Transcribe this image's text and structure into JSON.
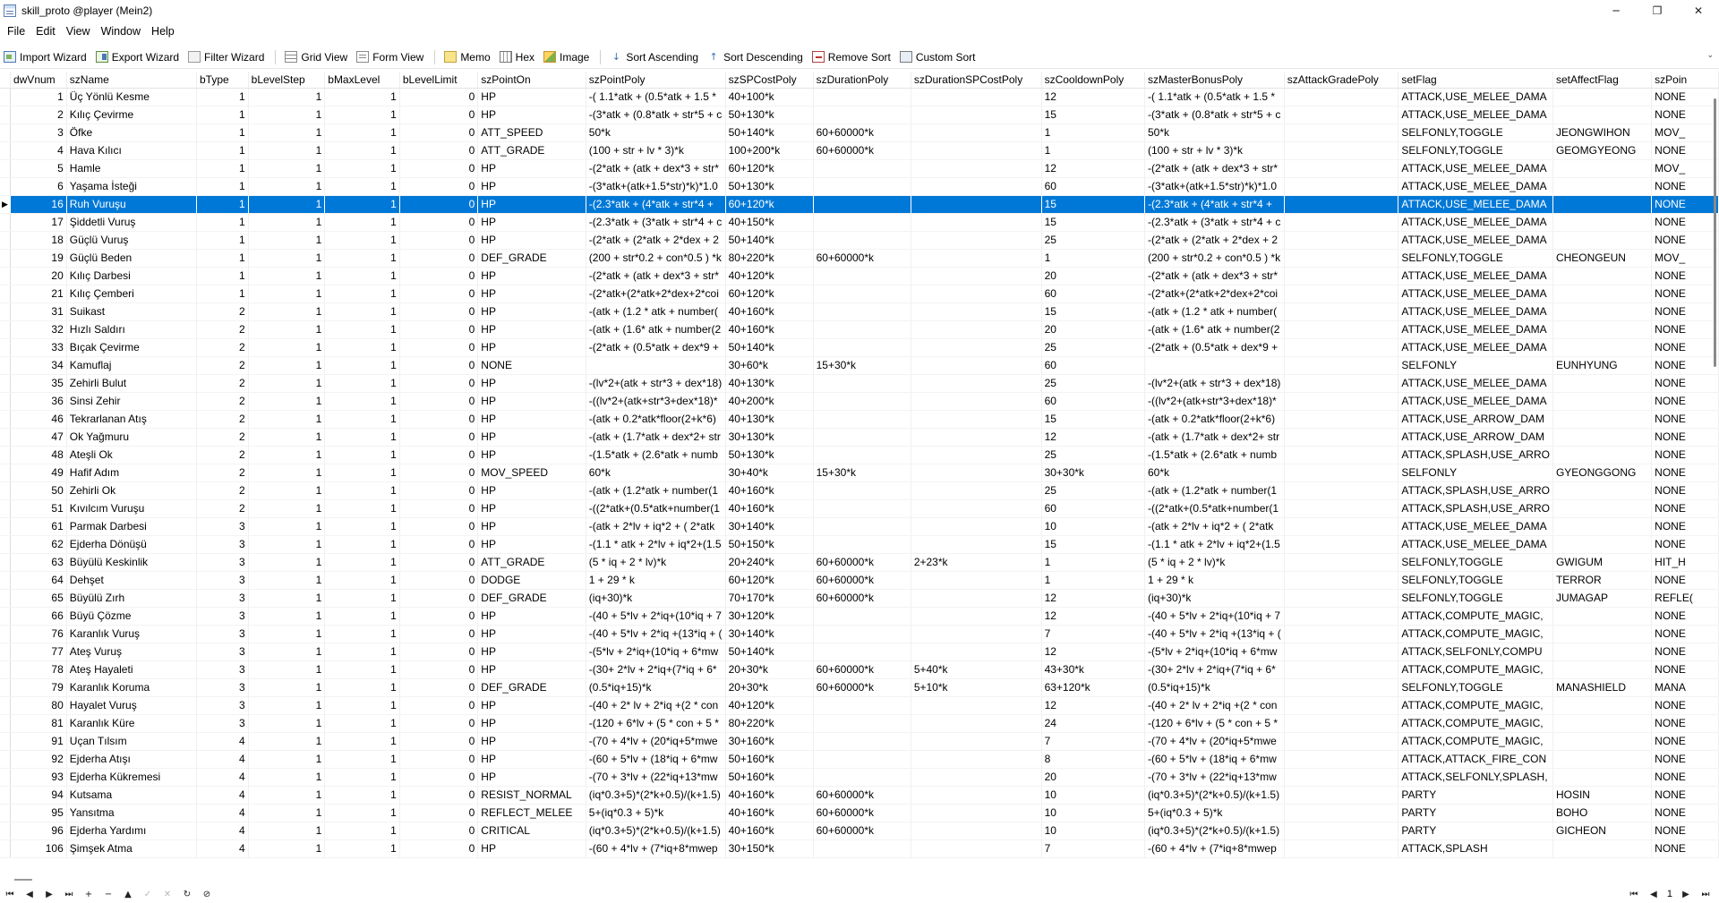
{
  "window": {
    "title": "skill_proto @player (Mein2)",
    "minimize_glyph": "─",
    "maximize_glyph": "❐",
    "close_glyph": "✕"
  },
  "menu": [
    "File",
    "Edit",
    "View",
    "Window",
    "Help"
  ],
  "toolbar": [
    {
      "label": "Import Wizard",
      "icon": "import-wizard-icon"
    },
    {
      "label": "Export Wizard",
      "icon": "export-wizard-icon"
    },
    {
      "label": "Filter Wizard",
      "icon": "filter-wizard-icon"
    },
    {
      "label": "Grid View",
      "icon": "grid-view-icon"
    },
    {
      "label": "Form View",
      "icon": "form-view-icon"
    },
    {
      "label": "Memo",
      "icon": "memo-icon"
    },
    {
      "label": "Hex",
      "icon": "hex-icon"
    },
    {
      "label": "Image",
      "icon": "image-icon"
    },
    {
      "label": "Sort Ascending",
      "icon": "sort-ascending-icon"
    },
    {
      "label": "Sort Descending",
      "icon": "sort-descending-icon"
    },
    {
      "label": "Remove Sort",
      "icon": "remove-sort-icon"
    },
    {
      "label": "Custom Sort",
      "icon": "custom-sort-icon"
    }
  ],
  "grid": {
    "columns": [
      "dwVnum",
      "szName",
      "bType",
      "bLevelStep",
      "bMaxLevel",
      "bLevelLimit",
      "szPointOn",
      "szPointPoly",
      "szSPCostPoly",
      "szDurationPoly",
      "szDurationSPCostPoly",
      "szCooldownPoly",
      "szMasterBonusPoly",
      "szAttackGradePoly",
      "setFlag",
      "setAffectFlag",
      "szPoin"
    ],
    "selected_row_indicator": "▶",
    "rows": [
      [
        "1",
        "Üç Yönlü Kesme",
        "1",
        "1",
        "1",
        "0",
        "HP",
        "-( 1.1*atk + (0.5*atk + 1.5 *",
        "40+100*k",
        "",
        "",
        "12",
        "-( 1.1*atk + (0.5*atk + 1.5 *",
        "",
        "ATTACK,USE_MELEE_DAMA",
        "",
        "NONE"
      ],
      [
        "2",
        "Kılıç Çevirme",
        "1",
        "1",
        "1",
        "0",
        "HP",
        "-(3*atk + (0.8*atk + str*5 + c",
        "50+130*k",
        "",
        "",
        "15",
        "-(3*atk + (0.8*atk + str*5 + c",
        "",
        "ATTACK,USE_MELEE_DAMA",
        "",
        "NONE"
      ],
      [
        "3",
        "Öfke",
        "1",
        "1",
        "1",
        "0",
        "ATT_SPEED",
        "50*k",
        "50+140*k",
        "60+60000*k",
        "",
        "1",
        "50*k",
        "",
        "SELFONLY,TOGGLE",
        "JEONGWIHON",
        "MOV_"
      ],
      [
        "4",
        "Hava Kılıcı",
        "1",
        "1",
        "1",
        "0",
        "ATT_GRADE",
        "(100 + str + lv * 3)*k",
        "100+200*k",
        "60+60000*k",
        "",
        "1",
        "(100 + str + lv * 3)*k",
        "",
        "SELFONLY,TOGGLE",
        "GEOMGYEONG",
        "NONE"
      ],
      [
        "5",
        "Hamle",
        "1",
        "1",
        "1",
        "0",
        "HP",
        "-(2*atk + (atk + dex*3 + str*",
        "60+120*k",
        "",
        "",
        "12",
        "-(2*atk + (atk + dex*3 + str*",
        "",
        "ATTACK,USE_MELEE_DAMA",
        "",
        "MOV_"
      ],
      [
        "6",
        "Yaşama İsteği",
        "1",
        "1",
        "1",
        "0",
        "HP",
        "-(3*atk+(atk+1.5*str)*k)*1.0",
        "50+130*k",
        "",
        "",
        "60",
        "-(3*atk+(atk+1.5*str)*k)*1.0",
        "",
        "ATTACK,USE_MELEE_DAMA",
        "",
        "NONE"
      ],
      [
        "16",
        "Ruh Vuruşu",
        "1",
        "1",
        "1",
        "0",
        "HP",
        "-(2.3*atk + (4*atk + str*4 +",
        "60+120*k",
        "",
        "",
        "15",
        "-(2.3*atk + (4*atk + str*4 +",
        "",
        "ATTACK,USE_MELEE_DAMA",
        "",
        "NONE"
      ],
      [
        "17",
        "Şiddetli Vuruş",
        "1",
        "1",
        "1",
        "0",
        "HP",
        "-(2.3*atk + (3*atk + str*4 + c",
        "40+150*k",
        "",
        "",
        "15",
        "-(2.3*atk + (3*atk + str*4 + c",
        "",
        "ATTACK,USE_MELEE_DAMA",
        "",
        "NONE"
      ],
      [
        "18",
        "Güçlü Vuruş",
        "1",
        "1",
        "1",
        "0",
        "HP",
        "-(2*atk + (2*atk + 2*dex + 2",
        "50+140*k",
        "",
        "",
        "25",
        "-(2*atk + (2*atk + 2*dex + 2",
        "",
        "ATTACK,USE_MELEE_DAMA",
        "",
        "NONE"
      ],
      [
        "19",
        "Güçlü Beden",
        "1",
        "1",
        "1",
        "0",
        "DEF_GRADE",
        "(200 + str*0.2 + con*0.5 ) *k",
        "80+220*k",
        "60+60000*k",
        "",
        "1",
        "(200 + str*0.2 + con*0.5 ) *k",
        "",
        "SELFONLY,TOGGLE",
        "CHEONGEUN",
        "MOV_"
      ],
      [
        "20",
        "Kılıç Darbesi",
        "1",
        "1",
        "1",
        "0",
        "HP",
        "-(2*atk + (atk + dex*3 + str*",
        "40+120*k",
        "",
        "",
        "20",
        "-(2*atk + (atk + dex*3 + str*",
        "",
        "ATTACK,USE_MELEE_DAMA",
        "",
        "NONE"
      ],
      [
        "21",
        "Kılıç Çemberi",
        "1",
        "1",
        "1",
        "0",
        "HP",
        "-(2*atk+(2*atk+2*dex+2*coi",
        "60+120*k",
        "",
        "",
        "60",
        "-(2*atk+(2*atk+2*dex+2*coi",
        "",
        "ATTACK,USE_MELEE_DAMA",
        "",
        "NONE"
      ],
      [
        "31",
        "Suikast",
        "2",
        "1",
        "1",
        "0",
        "HP",
        "-(atk + (1.2 * atk + number(",
        "40+160*k",
        "",
        "",
        "15",
        "-(atk + (1.2 * atk + number(",
        "",
        "ATTACK,USE_MELEE_DAMA",
        "",
        "NONE"
      ],
      [
        "32",
        "Hızlı Saldırı",
        "2",
        "1",
        "1",
        "0",
        "HP",
        "-(atk + (1.6* atk + number(2",
        "40+160*k",
        "",
        "",
        "20",
        "-(atk + (1.6* atk + number(2",
        "",
        "ATTACK,USE_MELEE_DAMA",
        "",
        "NONE"
      ],
      [
        "33",
        "Bıçak Çevirme",
        "2",
        "1",
        "1",
        "0",
        "HP",
        "-(2*atk + (0.5*atk + dex*9 +",
        "50+140*k",
        "",
        "",
        "25",
        "-(2*atk + (0.5*atk + dex*9 +",
        "",
        "ATTACK,USE_MELEE_DAMA",
        "",
        "NONE"
      ],
      [
        "34",
        "Kamuflaj",
        "2",
        "1",
        "1",
        "0",
        "NONE",
        "",
        "30+60*k",
        "15+30*k",
        "",
        "60",
        "",
        "",
        "SELFONLY",
        "EUNHYUNG",
        "NONE"
      ],
      [
        "35",
        "Zehirli Bulut",
        "2",
        "1",
        "1",
        "0",
        "HP",
        "-(lv*2+(atk + str*3 + dex*18)",
        "40+130*k",
        "",
        "",
        "25",
        "-(lv*2+(atk + str*3 + dex*18)",
        "",
        "ATTACK,USE_MELEE_DAMA",
        "",
        "NONE"
      ],
      [
        "36",
        "Sinsi Zehir",
        "2",
        "1",
        "1",
        "0",
        "HP",
        "-((lv*2+(atk+str*3+dex*18)*",
        "40+200*k",
        "",
        "",
        "60",
        "-((lv*2+(atk+str*3+dex*18)*",
        "",
        "ATTACK,USE_MELEE_DAMA",
        "",
        "NONE"
      ],
      [
        "46",
        "Tekrarlanan Atış",
        "2",
        "1",
        "1",
        "0",
        "HP",
        "-(atk + 0.2*atk*floor(2+k*6)",
        "40+130*k",
        "",
        "",
        "15",
        "-(atk + 0.2*atk*floor(2+k*6)",
        "",
        "ATTACK,USE_ARROW_DAM",
        "",
        "NONE"
      ],
      [
        "47",
        "Ok Yağmuru",
        "2",
        "1",
        "1",
        "0",
        "HP",
        "-(atk + (1.7*atk + dex*2+ str",
        "30+130*k",
        "",
        "",
        "12",
        "-(atk + (1.7*atk + dex*2+ str",
        "",
        "ATTACK,USE_ARROW_DAM",
        "",
        "NONE"
      ],
      [
        "48",
        "Ateşli Ok",
        "2",
        "1",
        "1",
        "0",
        "HP",
        "-(1.5*atk + (2.6*atk + numb",
        "50+130*k",
        "",
        "",
        "25",
        "-(1.5*atk + (2.6*atk + numb",
        "",
        "ATTACK,SPLASH,USE_ARRO",
        "",
        "NONE"
      ],
      [
        "49",
        "Hafif Adım",
        "2",
        "1",
        "1",
        "0",
        "MOV_SPEED",
        "60*k",
        "30+40*k",
        "15+30*k",
        "",
        "30+30*k",
        "60*k",
        "",
        "SELFONLY",
        "GYEONGGONG",
        "NONE"
      ],
      [
        "50",
        "Zehirli Ok",
        "2",
        "1",
        "1",
        "0",
        "HP",
        "-(atk + (1.2*atk + number(1",
        "40+160*k",
        "",
        "",
        "25",
        "-(atk + (1.2*atk + number(1",
        "",
        "ATTACK,SPLASH,USE_ARRO",
        "",
        "NONE"
      ],
      [
        "51",
        "Kıvılcım Vuruşu",
        "2",
        "1",
        "1",
        "0",
        "HP",
        "-((2*atk+(0.5*atk+number(1",
        "40+160*k",
        "",
        "",
        "60",
        "-((2*atk+(0.5*atk+number(1",
        "",
        "ATTACK,SPLASH,USE_ARRO",
        "",
        "NONE"
      ],
      [
        "61",
        "Parmak Darbesi",
        "3",
        "1",
        "1",
        "0",
        "HP",
        "-(atk + 2*lv + iq*2 + ( 2*atk",
        "30+140*k",
        "",
        "",
        "10",
        "-(atk + 2*lv + iq*2 + ( 2*atk",
        "",
        "ATTACK,USE_MELEE_DAMA",
        "",
        "NONE"
      ],
      [
        "62",
        "Ejderha Dönüşü",
        "3",
        "1",
        "1",
        "0",
        "HP",
        "-(1.1 * atk + 2*lv + iq*2+(1.5",
        "50+150*k",
        "",
        "",
        "15",
        "-(1.1 * atk + 2*lv + iq*2+(1.5",
        "",
        "ATTACK,USE_MELEE_DAMA",
        "",
        "NONE"
      ],
      [
        "63",
        "Büyülü Keskinlik",
        "3",
        "1",
        "1",
        "0",
        "ATT_GRADE",
        "(5 * iq + 2 * lv)*k",
        "20+240*k",
        "60+60000*k",
        "2+23*k",
        "1",
        "(5 * iq + 2 * lv)*k",
        "",
        "SELFONLY,TOGGLE",
        "GWIGUM",
        "HIT_H"
      ],
      [
        "64",
        "Dehşet",
        "3",
        "1",
        "1",
        "0",
        "DODGE",
        "1 + 29 * k",
        "60+120*k",
        "60+60000*k",
        "",
        "1",
        "1 + 29 * k",
        "",
        "SELFONLY,TOGGLE",
        "TERROR",
        "NONE"
      ],
      [
        "65",
        "Büyülü Zırh",
        "3",
        "1",
        "1",
        "0",
        "DEF_GRADE",
        "(iq+30)*k",
        "70+170*k",
        "60+60000*k",
        "",
        "12",
        "(iq+30)*k",
        "",
        "SELFONLY,TOGGLE",
        "JUMAGAP",
        "REFLE("
      ],
      [
        "66",
        "Büyü Çözme",
        "3",
        "1",
        "1",
        "0",
        "HP",
        "-(40 + 5*lv + 2*iq+(10*iq + 7",
        "30+120*k",
        "",
        "",
        "12",
        "-(40 + 5*lv + 2*iq+(10*iq + 7",
        "",
        "ATTACK,COMPUTE_MAGIC,",
        "",
        "NONE"
      ],
      [
        "76",
        "Karanlık Vuruş",
        "3",
        "1",
        "1",
        "0",
        "HP",
        "-(40 + 5*lv + 2*iq +(13*iq + (",
        "30+140*k",
        "",
        "",
        "7",
        "-(40 + 5*lv + 2*iq +(13*iq + (",
        "",
        "ATTACK,COMPUTE_MAGIC,",
        "",
        "NONE"
      ],
      [
        "77",
        "Ateş Vuruş",
        "3",
        "1",
        "1",
        "0",
        "HP",
        "-(5*lv + 2*iq+(10*iq + 6*mw",
        "50+140*k",
        "",
        "",
        "12",
        "-(5*lv + 2*iq+(10*iq + 6*mw",
        "",
        "ATTACK,SELFONLY,COMPU",
        "",
        "NONE"
      ],
      [
        "78",
        "Ateş Hayaleti",
        "3",
        "1",
        "1",
        "0",
        "HP",
        "-(30+ 2*lv + 2*iq+(7*iq + 6*",
        "20+30*k",
        "60+60000*k",
        "5+40*k",
        "43+30*k",
        "-(30+ 2*lv + 2*iq+(7*iq + 6*",
        "",
        "ATTACK,COMPUTE_MAGIC,",
        "",
        "NONE"
      ],
      [
        "79",
        "Karanlık Koruma",
        "3",
        "1",
        "1",
        "0",
        "DEF_GRADE",
        "(0.5*iq+15)*k",
        "20+30*k",
        "60+60000*k",
        "5+10*k",
        "63+120*k",
        "(0.5*iq+15)*k",
        "",
        "SELFONLY,TOGGLE",
        "MANASHIELD",
        "MANA"
      ],
      [
        "80",
        "Hayalet Vuruş",
        "3",
        "1",
        "1",
        "0",
        "HP",
        "-(40 + 2* lv + 2*iq +(2 * con",
        "40+120*k",
        "",
        "",
        "12",
        "-(40 + 2* lv + 2*iq +(2 * con",
        "",
        "ATTACK,COMPUTE_MAGIC,",
        "",
        "NONE"
      ],
      [
        "81",
        "Karanlık Küre",
        "3",
        "1",
        "1",
        "0",
        "HP",
        "-(120 + 6*lv + (5 * con + 5 *",
        "80+220*k",
        "",
        "",
        "24",
        "-(120 + 6*lv + (5 * con + 5 *",
        "",
        "ATTACK,COMPUTE_MAGIC,",
        "",
        "NONE"
      ],
      [
        "91",
        "Uçan Tılsım",
        "4",
        "1",
        "1",
        "0",
        "HP",
        "-(70 + 4*lv + (20*iq+5*mwe",
        "30+160*k",
        "",
        "",
        "7",
        "-(70 + 4*lv + (20*iq+5*mwe",
        "",
        "ATTACK,COMPUTE_MAGIC,",
        "",
        "NONE"
      ],
      [
        "92",
        "Ejderha Atışı",
        "4",
        "1",
        "1",
        "0",
        "HP",
        "-(60 + 5*lv + (18*iq + 6*mw",
        "50+160*k",
        "",
        "",
        "8",
        "-(60 + 5*lv + (18*iq + 6*mw",
        "",
        "ATTACK,ATTACK_FIRE_CON",
        "",
        "NONE"
      ],
      [
        "93",
        "Ejderha Kükremesi",
        "4",
        "1",
        "1",
        "0",
        "HP",
        "-(70 + 3*lv + (22*iq+13*mw",
        "50+160*k",
        "",
        "",
        "20",
        "-(70 + 3*lv + (22*iq+13*mw",
        "",
        "ATTACK,SELFONLY,SPLASH,",
        "",
        "NONE"
      ],
      [
        "94",
        "Kutsama",
        "4",
        "1",
        "1",
        "0",
        "RESIST_NORMAL",
        "(iq*0.3+5)*(2*k+0.5)/(k+1.5)",
        "40+160*k",
        "60+60000*k",
        "",
        "10",
        "(iq*0.3+5)*(2*k+0.5)/(k+1.5)",
        "",
        "PARTY",
        "HOSIN",
        "NONE"
      ],
      [
        "95",
        "Yansıtma",
        "4",
        "1",
        "1",
        "0",
        "REFLECT_MELEE",
        "5+(iq*0.3 + 5)*k",
        "40+160*k",
        "60+60000*k",
        "",
        "10",
        "5+(iq*0.3 + 5)*k",
        "",
        "PARTY",
        "BOHO",
        "NONE"
      ],
      [
        "96",
        "Ejderha Yardımı",
        "4",
        "1",
        "1",
        "0",
        "CRITICAL",
        "(iq*0.3+5)*(2*k+0.5)/(k+1.5)",
        "40+160*k",
        "60+60000*k",
        "",
        "10",
        "(iq*0.3+5)*(2*k+0.5)/(k+1.5)",
        "",
        "PARTY",
        "GICHEON",
        "NONE"
      ],
      [
        "106",
        "Şimşek Atma",
        "4",
        "1",
        "1",
        "0",
        "HP",
        "-(60 + 4*lv + (7*iq+8*mwep",
        "30+150*k",
        "",
        "",
        "7",
        "-(60 + 4*lv + (7*iq+8*mwep",
        "",
        "ATTACK,SPLASH",
        "",
        "NONE"
      ]
    ],
    "selected_row": 6
  },
  "navigator": {
    "left_buttons": [
      {
        "name": "nav-first-icon",
        "glyph": "⏮"
      },
      {
        "name": "nav-prev-icon",
        "glyph": "◀"
      },
      {
        "name": "nav-next-icon",
        "glyph": "▶"
      },
      {
        "name": "nav-last-icon",
        "glyph": "⏭"
      },
      {
        "name": "nav-add-icon",
        "glyph": "+"
      },
      {
        "name": "nav-delete-icon",
        "glyph": "−"
      },
      {
        "name": "nav-up-icon",
        "glyph": "▲"
      },
      {
        "name": "nav-apply-icon",
        "glyph": "✓",
        "disabled": true
      },
      {
        "name": "nav-cancel-icon",
        "glyph": "✕",
        "disabled": true
      },
      {
        "name": "nav-refresh-icon",
        "glyph": "↻"
      },
      {
        "name": "nav-stop-icon",
        "glyph": "⊘"
      }
    ],
    "page_number": "1",
    "right_glyphs": {
      "first": "⏮",
      "prev": "◀",
      "next": "▶",
      "last": "⏭"
    }
  }
}
